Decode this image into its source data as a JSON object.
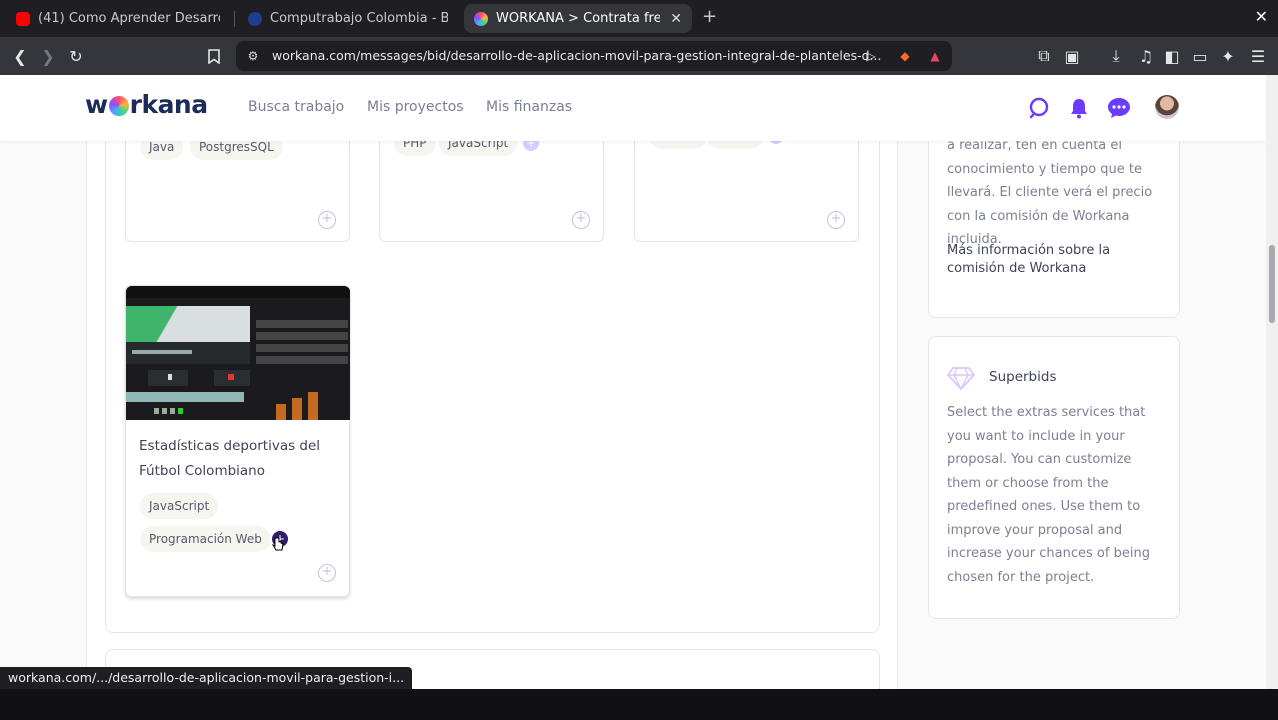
{
  "browser": {
    "tabs": [
      {
        "title": "(41) Como Aprender Desarrol",
        "favicon": "youtube-icon",
        "color": "#ff0000"
      },
      {
        "title": "Computrabajo Colombia - Bo",
        "favicon": "computrabajo-icon",
        "color": "#1d3d8f"
      },
      {
        "title": "WORKANA > Contrata fre",
        "favicon": "workana-icon",
        "active": true
      }
    ],
    "url": "workana.com/messages/bid/desarrollo-de-aplicacion-movil-para-gestion-integral-de-planteles-d...",
    "status_url": "workana.com/.../desarrollo-de-aplicacion-movil-para-gestion-i..."
  },
  "header": {
    "logo": "workana",
    "nav": [
      "Busca trabajo",
      "Mis proyectos",
      "Mis finanzas"
    ],
    "accent": "#6b3cff"
  },
  "portfolio": {
    "cards_top": [
      {
        "tags": [
          "Java",
          "PostgresSQL"
        ]
      },
      {
        "tags": [
          "PHP",
          "JavaScript"
        ]
      },
      {
        "tags": [
          "Flutter",
          "Scrum"
        ]
      }
    ],
    "featured": {
      "title": "Estadísticas deportivas del Fútbol Colombiano",
      "tags": [
        "JavaScript",
        "Programación Web"
      ]
    }
  },
  "sidebar": {
    "commission": {
      "text": "a realizar, ten en cuenta el conocimiento y tiempo que te llevará. El cliente verá el precio con la comisión de Workana incluida.",
      "link": "Más información sobre la comisión de Workana"
    },
    "superbids": {
      "title": "Superbids",
      "text": "Select the extras services that you want to include in your proposal. You can customize them or choose from the predefined ones. Use them to improve your proposal and increase your chances of being chosen for the project."
    }
  }
}
